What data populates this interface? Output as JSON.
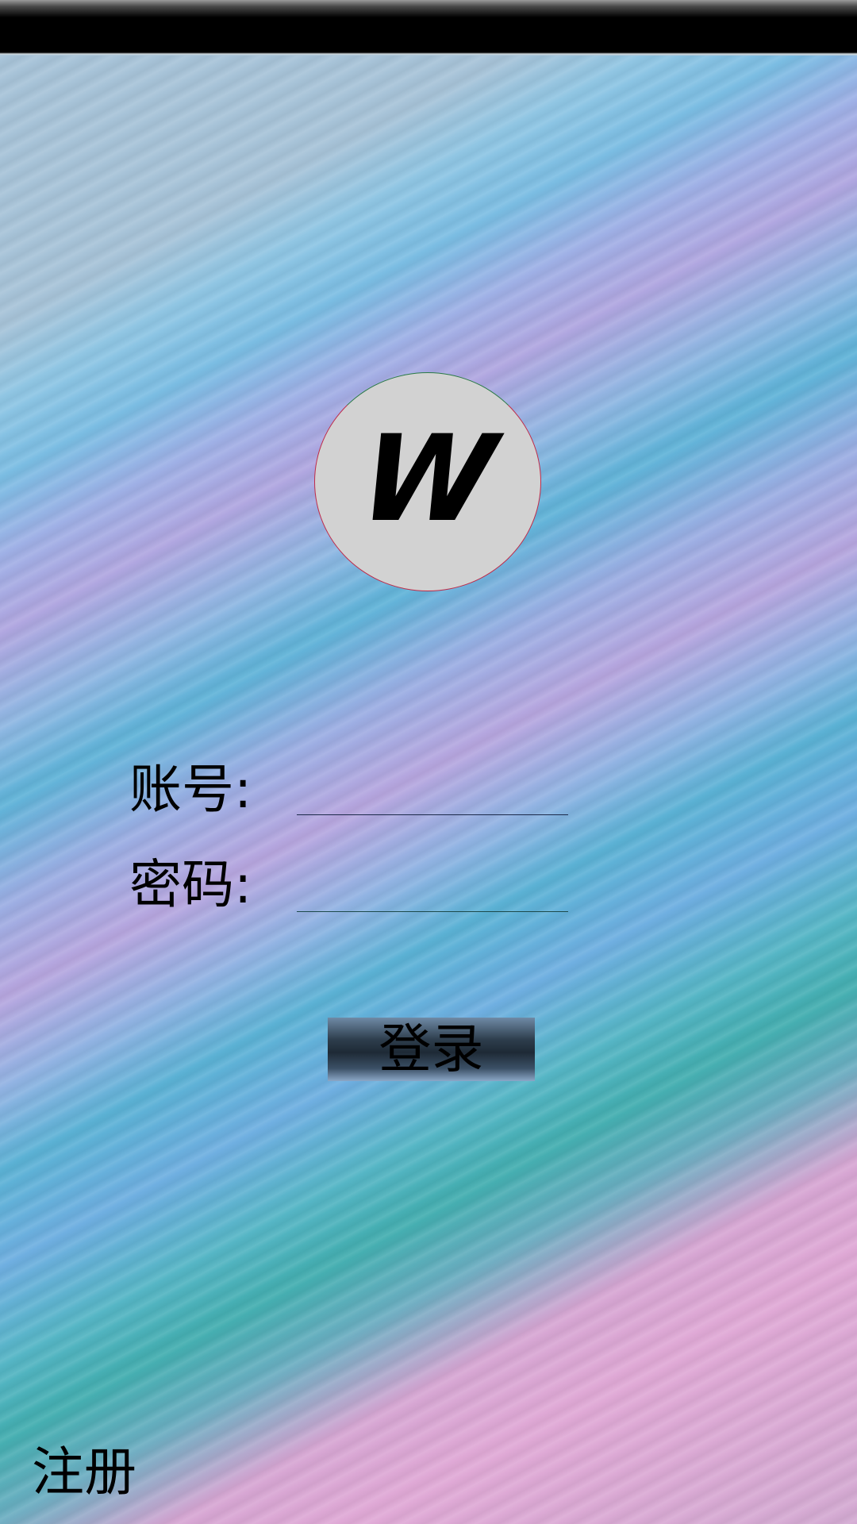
{
  "logo": {
    "letter": "W"
  },
  "login_form": {
    "account_label": "账号:",
    "account_value": "",
    "account_placeholder": "",
    "password_label": "密码:",
    "password_value": "",
    "password_placeholder": "",
    "login_button_label": "登录"
  },
  "footer": {
    "register_label": "注册"
  },
  "colors": {
    "status_bar": "#000000",
    "logo_background": "#d2d2d2",
    "text": "#000000"
  }
}
